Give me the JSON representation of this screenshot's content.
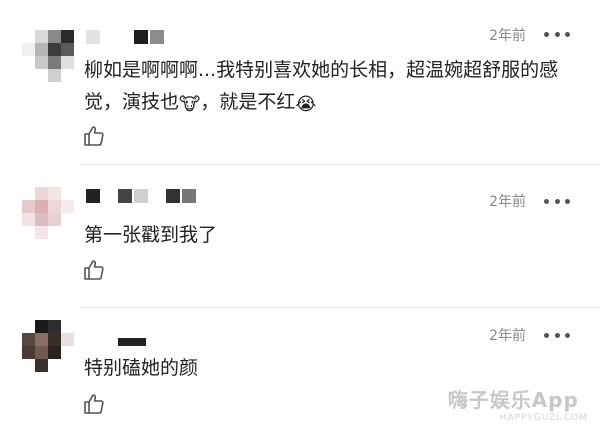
{
  "comments": [
    {
      "time": "2年前",
      "text_part1": "柳如是啊啊啊...我特别喜欢她的长相，超温婉超舒服的感觉，演技也",
      "emoji1": "🐮",
      "text_part2": "，就是不红",
      "emoji2": "😭"
    },
    {
      "time": "2年前",
      "text": "第一张戳到我了"
    },
    {
      "time": "2年前",
      "text": "特别磕她的颜"
    }
  ],
  "watermark": {
    "main": "嗨子娱乐App",
    "sub": "HAPPYGUZI.COM"
  },
  "icons": {
    "like": "thumbs-up-icon",
    "more": "more-dots-icon"
  },
  "colors": {
    "text": "#222222",
    "time": "#888888",
    "divider": "#e6e6e6"
  }
}
